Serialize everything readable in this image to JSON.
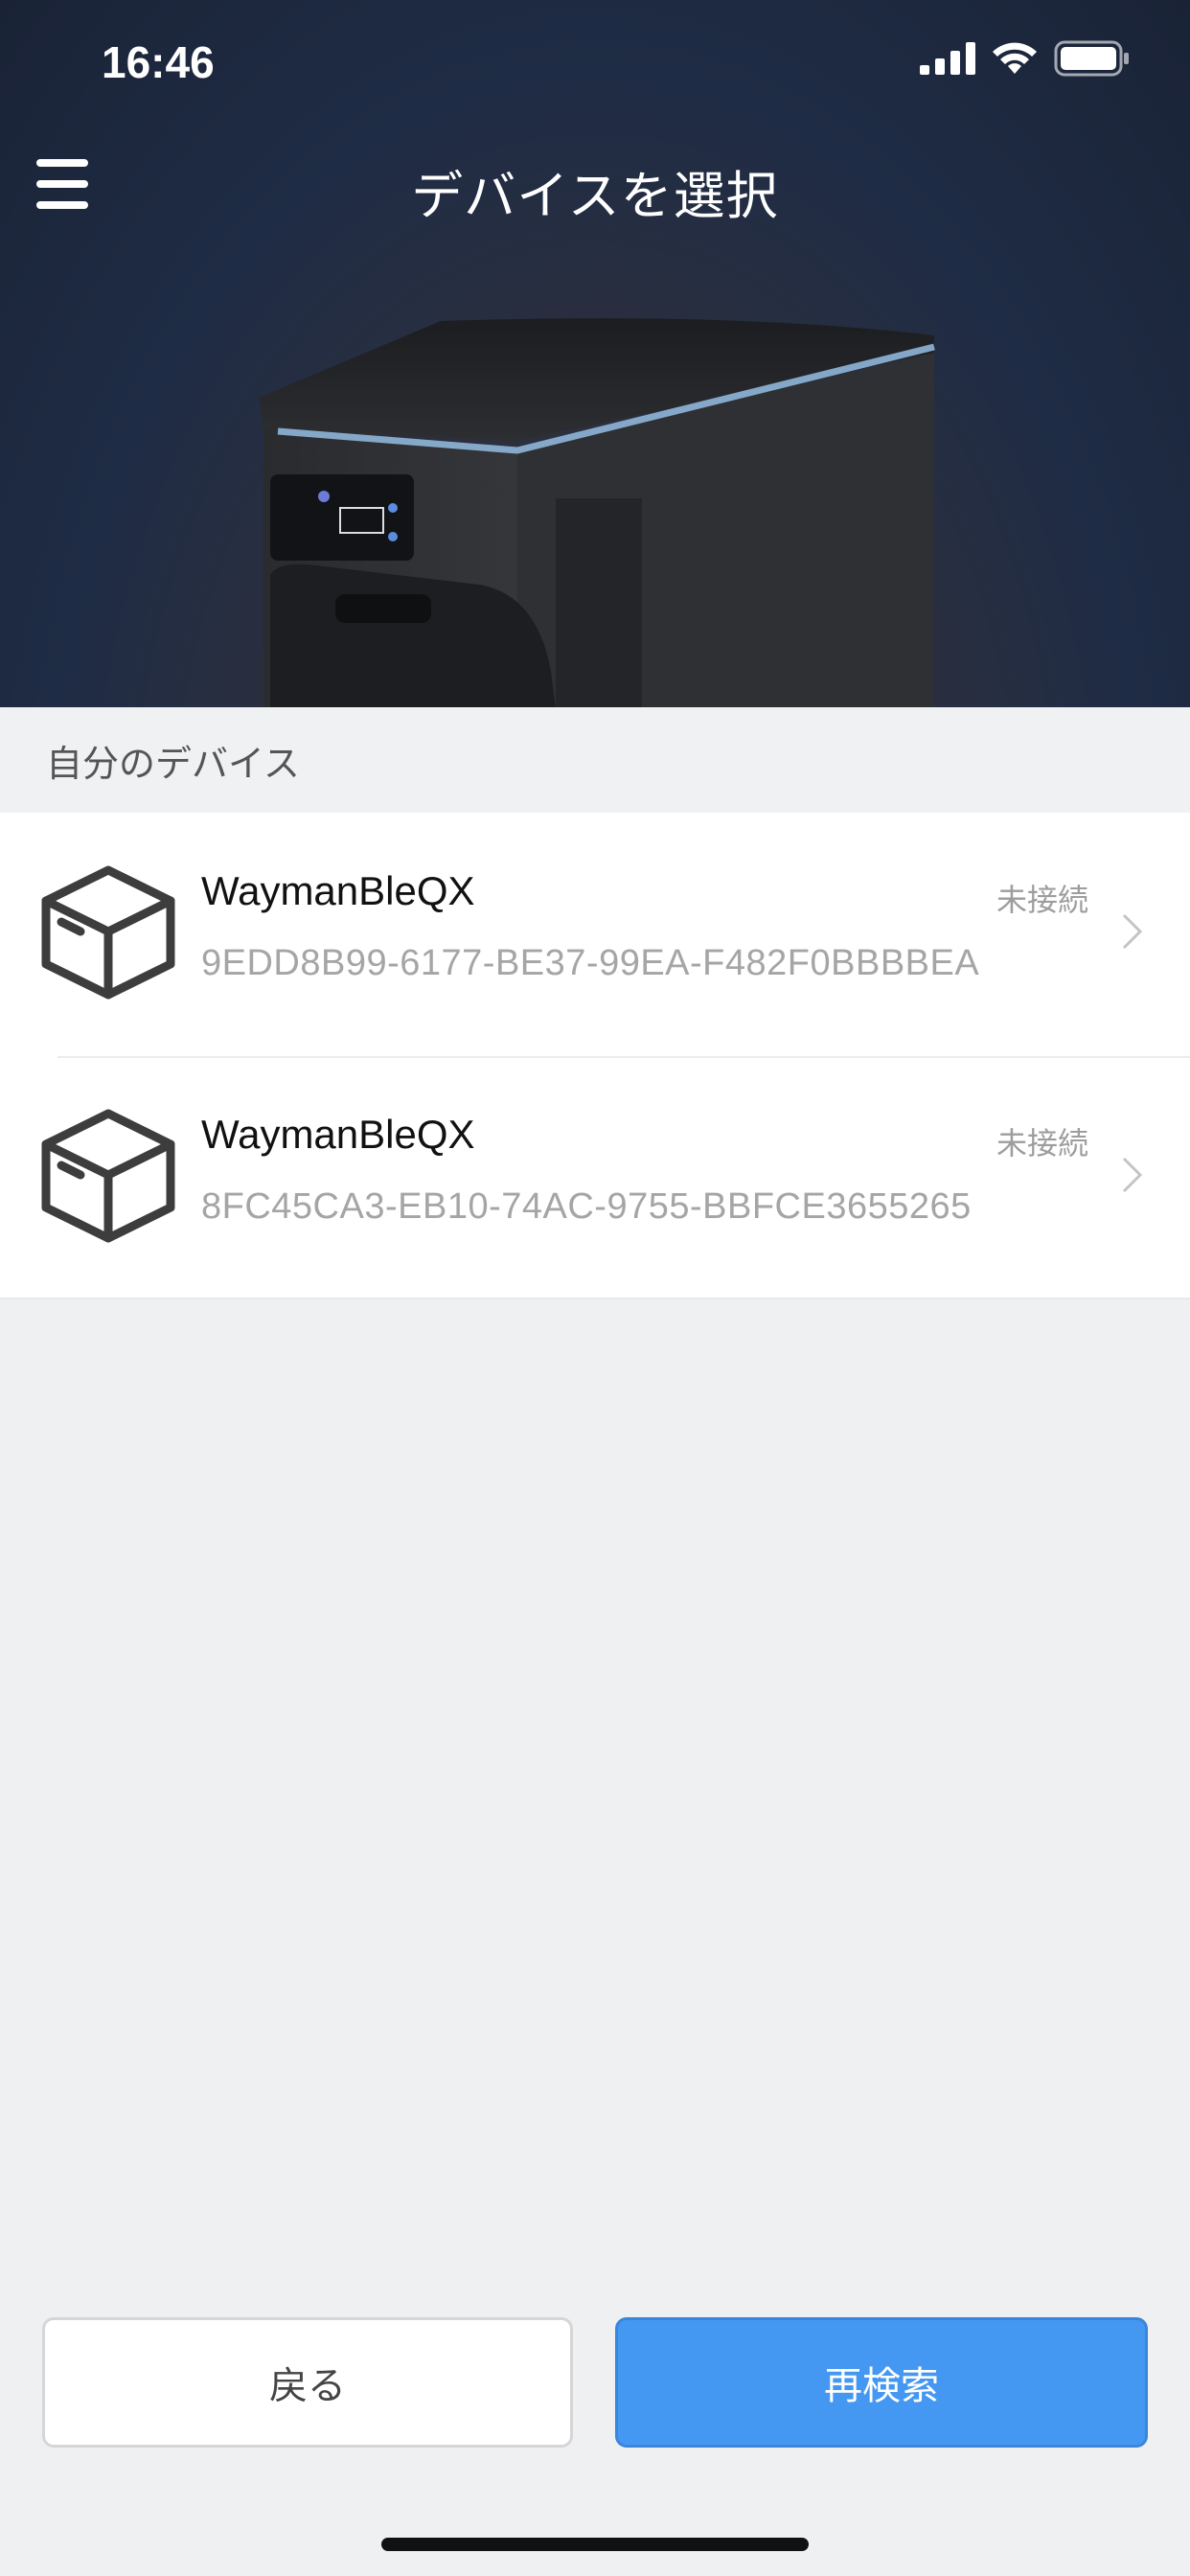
{
  "status_bar": {
    "time": "16:46",
    "icons": [
      "cellular-signal-icon",
      "wifi-icon",
      "battery-icon"
    ]
  },
  "nav": {
    "title": "デバイスを選択",
    "menu_icon": "hamburger-menu-icon"
  },
  "section": {
    "title": "自分のデバイス"
  },
  "devices": [
    {
      "name": "WaymanBleQX",
      "id": "9EDD8B99-6177-BE37-99EA-F482F0BBBBEA",
      "status": "未接続",
      "icon": "box-icon"
    },
    {
      "name": "WaymanBleQX",
      "id": "8FC45CA3-EB10-74AC-9755-BBFCE3655265",
      "status": "未接続",
      "icon": "box-icon"
    }
  ],
  "buttons": {
    "back_label": "戻る",
    "rescan_label": "再検索"
  },
  "colors": {
    "accent": "#4598f2",
    "hero_bg": "#1f2c45",
    "page_bg": "#eff0f2"
  }
}
